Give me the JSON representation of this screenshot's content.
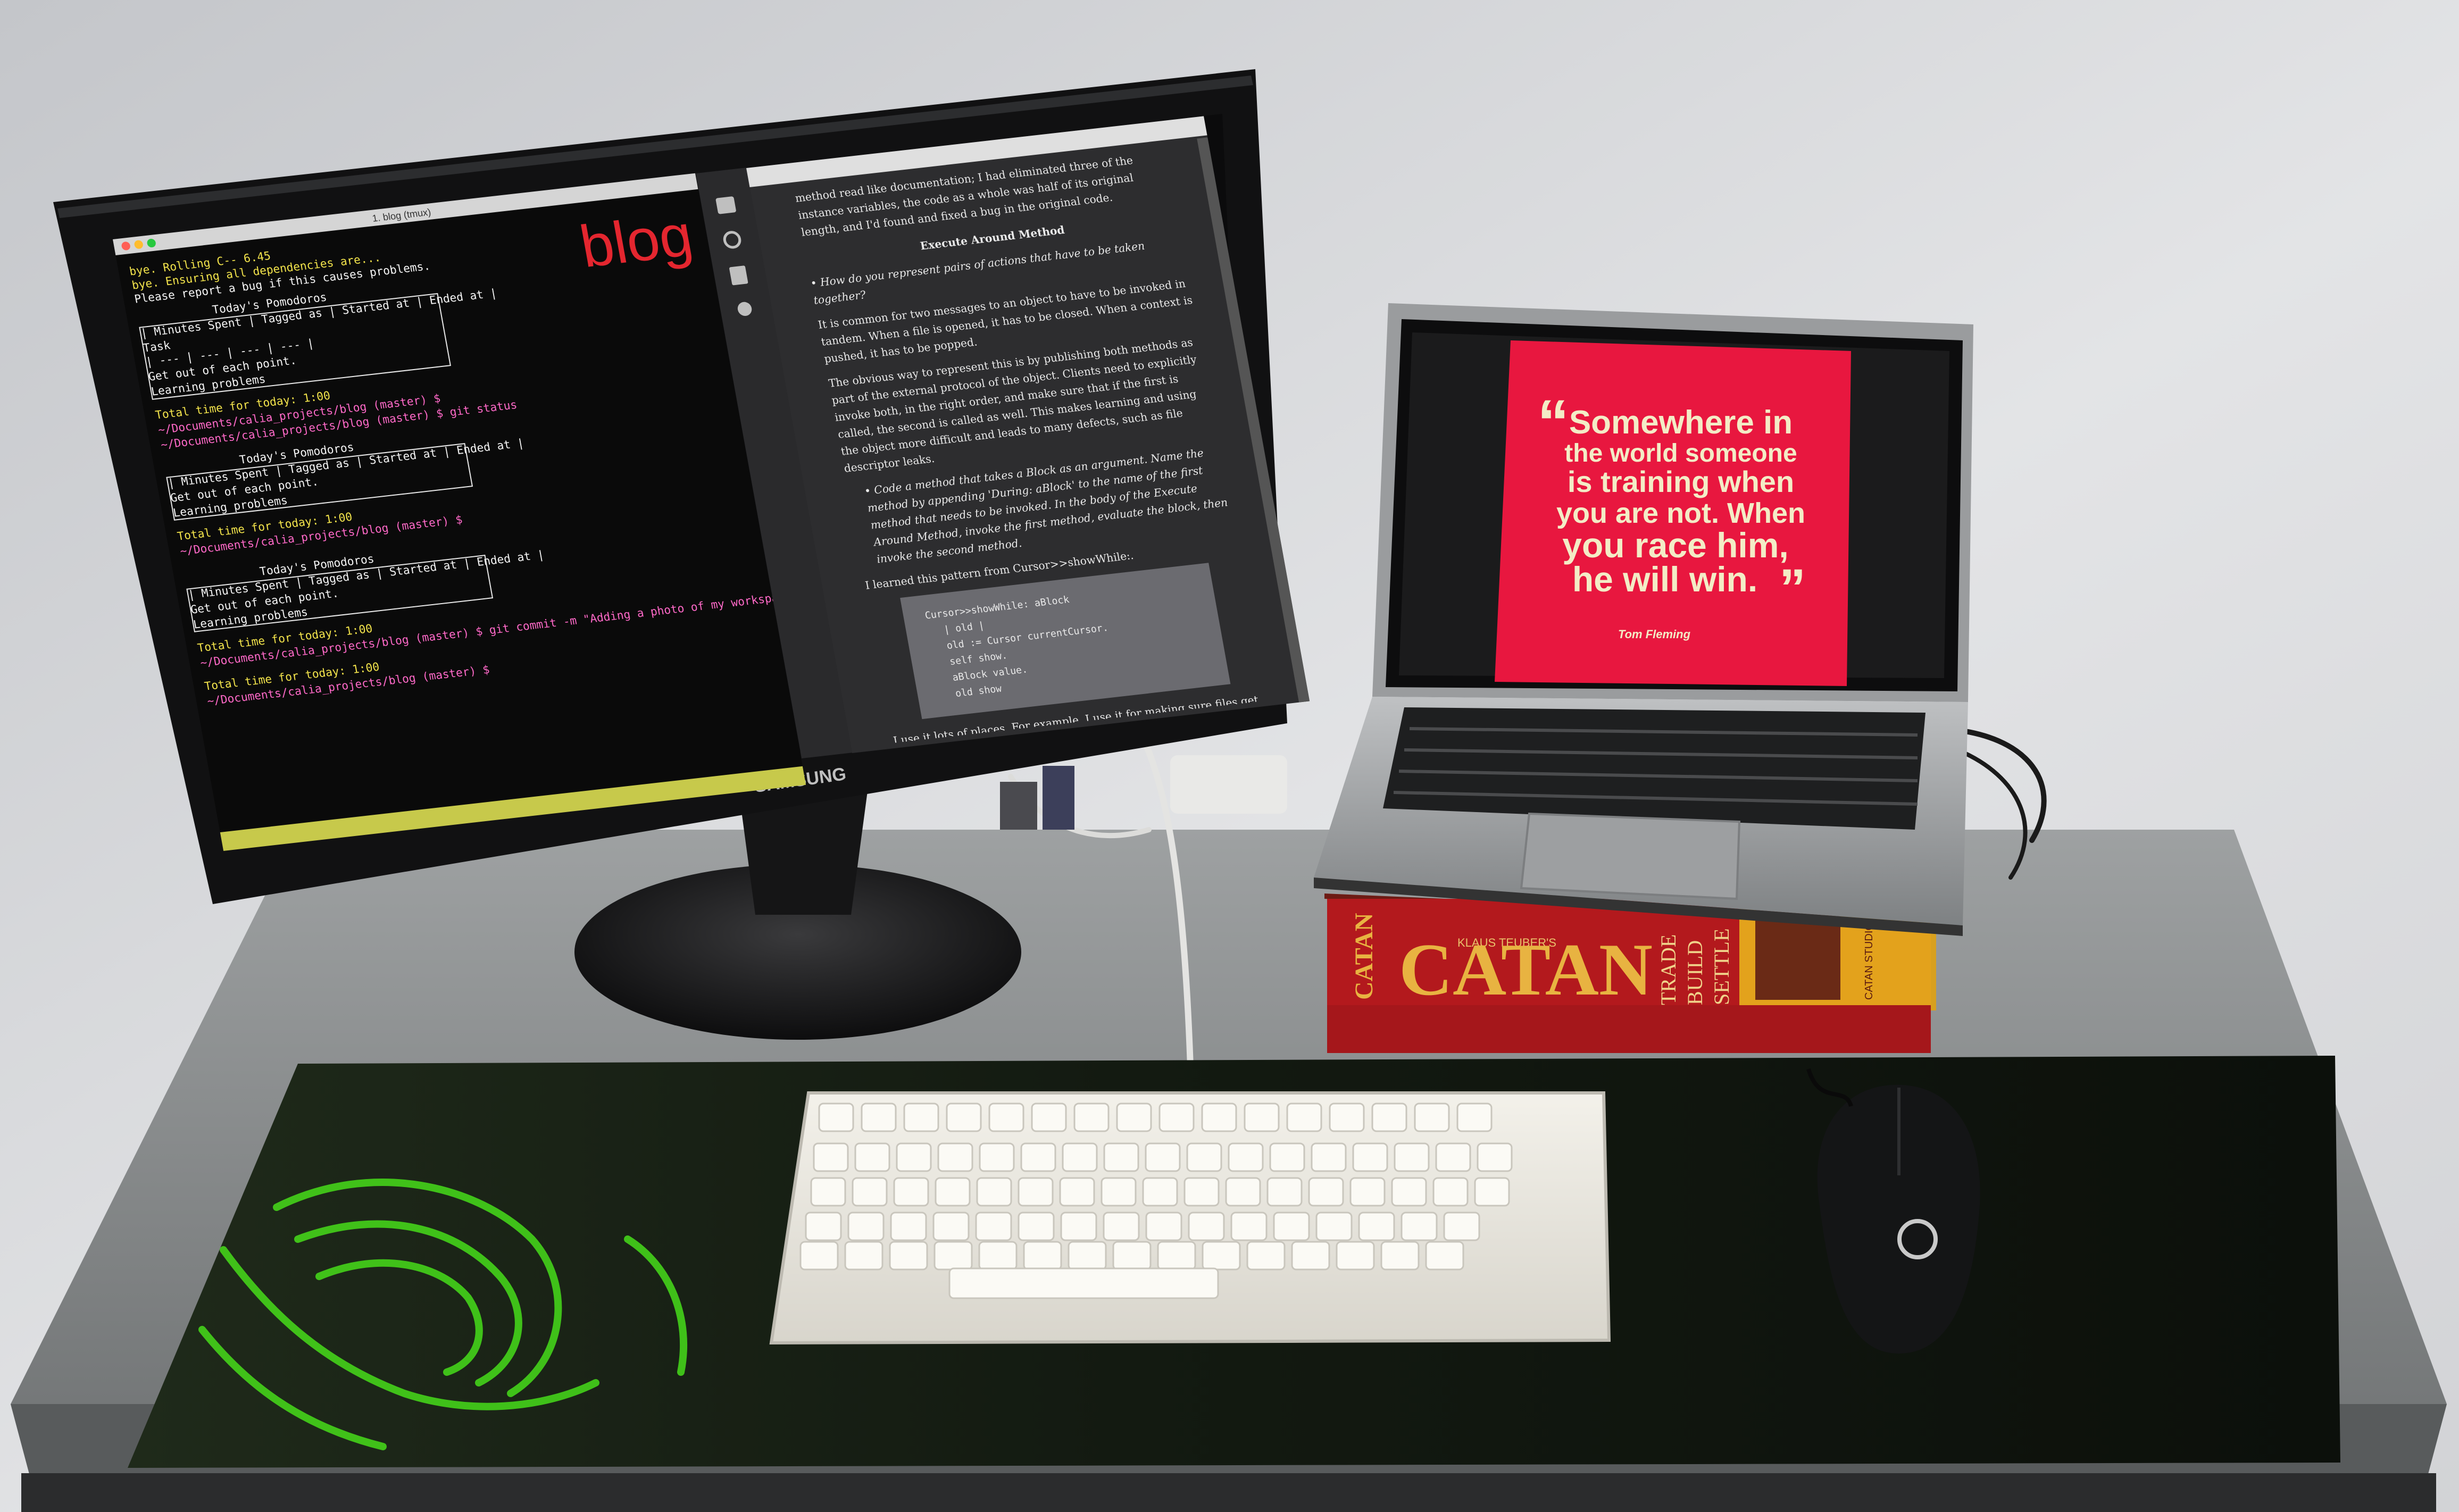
{
  "monitor": {
    "brand": "SAMSUNG",
    "window_title": "1. blog (tmux)",
    "terminal": {
      "overlay_word": "blog",
      "lines": [
        "bye.  Rolling C-- 6.45",
        "bye.  Ensuring all dependencies are...",
        "Please report a bug if this causes problems.",
        "Today's Pomodoros",
        "| Minutes Spent | Tagged as | Started at | Ended at |",
        "Task",
        "| --- | --- | --- | --- |",
        "Get out of each point.",
        "Learning problems",
        "Total time for today: 1:00",
        "~/Documents/calia_projects/blog (master) $",
        "~/Documents/calia_projects/blog (master) $ git status",
        "Today's Pomodoros",
        "| Minutes Spent | Tagged as | Started at | Ended at |",
        "Get out of each point.",
        "Learning problems",
        "Total time for today: 1:00",
        "~/Documents/calia_projects/blog (master) $",
        "Today's Pomodoros",
        "| Minutes Spent | Tagged as | Started at | Ended at |",
        "Get out of each point.",
        "Learning problems",
        "Total time for today: 1:00",
        "~/Documents/calia_projects/blog (master) $ git commit -m \"Adding a photo of my workspace\"",
        "Total time for today: 1:00",
        "~/Documents/calia_projects/blog (master) $"
      ]
    },
    "reader": {
      "paragraphs": [
        "method read like documentation; I had eliminated three of the instance variables, the code as a whole was half of its original length, and I'd found and fixed a bug in the original code.",
        "Execute Around Method",
        "• How do you represent pairs of actions that have to be taken together?",
        "It is common for two messages to an object to have to be invoked in tandem. When a file is opened, it has to be closed. When a context is pushed, it has to be popped.",
        "The obvious way to represent this is by publishing both methods as part of the external protocol of the object. Clients need to explicitly invoke both, in the right order, and make sure that if the first is called, the second is called as well. This makes learning and using the object more difficult and leads to many defects, such as file descriptor leaks.",
        "• Code a method that takes a Block as an argument. Name the method by appending 'During: aBlock' to the name of the first method that needs to be invoked. In the body of the Execute Around Method, invoke the first method, evaluate the block, then invoke the second method.",
        "I learned this pattern from Cursor>>showWhile:."
      ],
      "code": [
        "Cursor>>showWhile: aBlock",
        "| old |",
        "old := Cursor currentCursor.",
        "self show.",
        "aBlock value.",
        "old show"
      ],
      "footer": "I use it lots of places. For example, I use it for making sure files get closed."
    }
  },
  "laptop": {
    "quote_lines": [
      "Somewhere in",
      "the world someone",
      "is training when",
      "you are not. When",
      "you race him,",
      "he will win."
    ],
    "open_quote": "“",
    "close_quote": "”",
    "attribution": "Tom Fleming"
  },
  "game_box": {
    "author": "KLAUS TEUBER'S",
    "title": "CATAN",
    "side_logo": "CATAN",
    "tagline": [
      "TRADE",
      "BUILD",
      "SETTLE"
    ],
    "studio": "CATAN STUDIO"
  },
  "colors": {
    "wall": "#d9dadc",
    "poster_red": "#e8173f",
    "poster_text": "#f3ecc6",
    "razer_green": "#44d21a",
    "catan_red": "#b3191d",
    "catan_gold": "#e3a21c",
    "terminal_pink": "#ff69c8",
    "terminal_yellow": "#f2e34b",
    "blog_red": "#e4262f"
  },
  "icons": [
    "terminal-app",
    "razer-logo-icon",
    "mouse-logo-icon",
    "power-led-icon"
  ]
}
